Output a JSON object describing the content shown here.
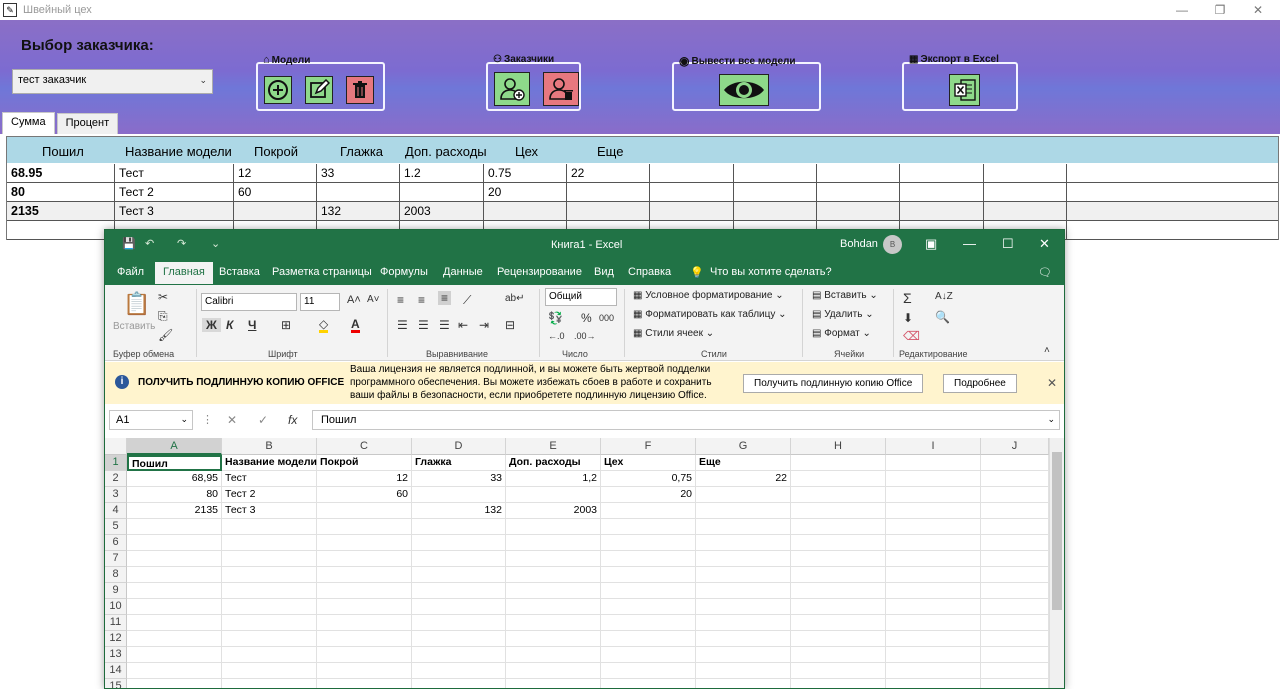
{
  "app": {
    "title": "Швейный цех",
    "customer_label": "Выбор заказчика:",
    "customer_selected": "тест заказчик",
    "groups": {
      "models": "Модели",
      "customers": "Заказчики",
      "show_all": "Вывести все модели",
      "export": "Экспорт в Excel"
    },
    "tabs": [
      "Сумма",
      "Процент"
    ],
    "columns": [
      "Пошил",
      "Название модели",
      "Покрой",
      "Глажка",
      "Доп. расходы",
      "Цех",
      "Еще"
    ],
    "rows": [
      [
        "68.95",
        "Тест",
        "12",
        "33",
        "1.2",
        "0.75",
        "22"
      ],
      [
        "80",
        "Тест 2",
        "60",
        "",
        "",
        "20",
        ""
      ],
      [
        "2135",
        "Тест 3",
        "",
        "132",
        "2003",
        "",
        ""
      ]
    ]
  },
  "excel": {
    "title": "Книга1  -  Excel",
    "user": "Bohdan",
    "avatar_initial": "B",
    "menu": [
      "Файл",
      "Главная",
      "Вставка",
      "Разметка страницы",
      "Формулы",
      "Данные",
      "Рецензирование",
      "Вид",
      "Справка",
      "Что вы хотите сделать?"
    ],
    "ribbon": {
      "paste": "Вставить",
      "clipboard": "Буфер обмена",
      "font_name": "Calibri",
      "font_size": "11",
      "font_group": "Шрифт",
      "bold": "Ж",
      "italic": "К",
      "underline": "Ч",
      "align_group": "Выравнивание",
      "number_format": "Общий",
      "number_group": "Число",
      "percent": "%",
      "thousands": "000",
      "cond_format": "Условное форматирование",
      "format_table": "Форматировать как таблицу",
      "cell_styles": "Стили ячеек",
      "styles_group": "Стили",
      "insert": "Вставить",
      "delete": "Удалить",
      "format": "Формат",
      "cells_group": "Ячейки",
      "editing_group": "Редактирование"
    },
    "warning": {
      "heading": "ПОЛУЧИТЬ ПОДЛИННУЮ КОПИЮ OFFICE",
      "message": "Ваша лицензия не является подлинной, и вы можете быть жертвой подделки программного обеспечения. Вы можете избежать сбоев в работе и сохранить ваши файлы в безопасности, если приобретете подлинную лицензию Office.",
      "button_get": "Получить подлинную копию Office",
      "button_more": "Подробнее"
    },
    "name_box": "A1",
    "formula": "Пошил",
    "col_headers": [
      "A",
      "B",
      "C",
      "D",
      "E",
      "F",
      "G",
      "H",
      "I",
      "J"
    ],
    "row_headers": [
      "1",
      "2",
      "3",
      "4",
      "5",
      "6",
      "7",
      "8",
      "9",
      "10",
      "11",
      "12",
      "13",
      "14",
      "15"
    ],
    "sheet": [
      [
        "Пошил",
        "Название модели",
        "Покрой",
        "Глажка",
        "Доп. расходы",
        "Цех",
        "Еще"
      ],
      [
        "68,95",
        "Тест",
        "12",
        "33",
        "1,2",
        "0,75",
        "22"
      ],
      [
        "80",
        "Тест 2",
        "60",
        "",
        "",
        "20",
        ""
      ],
      [
        "2135",
        "Тест 3",
        "",
        "132",
        "2003",
        "",
        ""
      ]
    ]
  }
}
